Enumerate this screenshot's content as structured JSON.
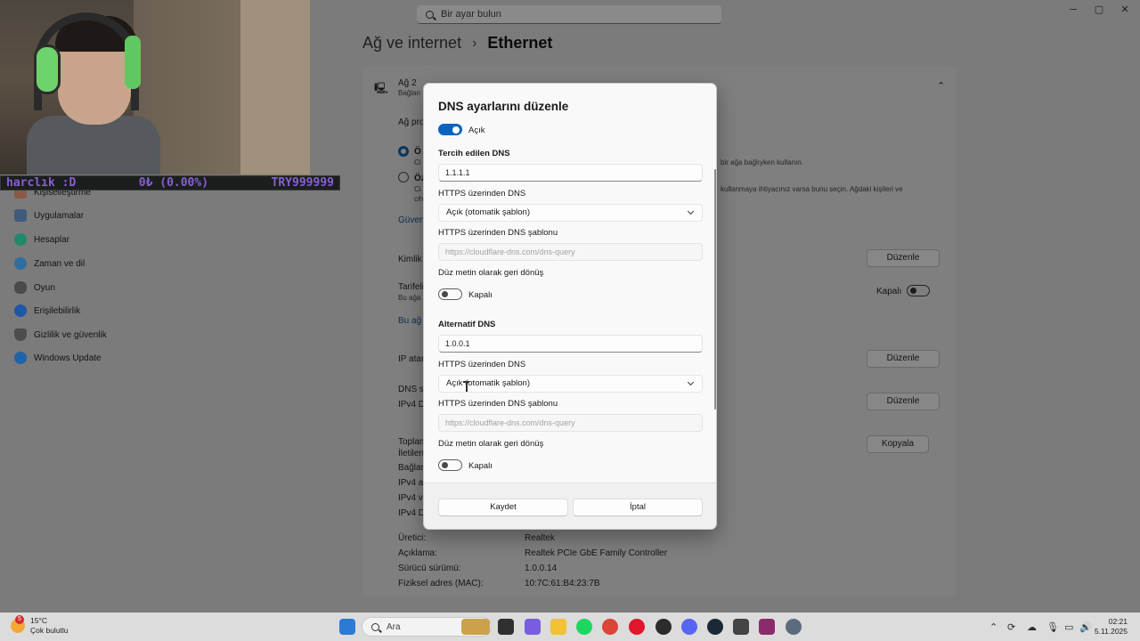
{
  "window": {
    "search_placeholder": "Bir ayar bulun",
    "minimize": "─",
    "maximize": "▢",
    "close": "✕"
  },
  "breadcrumb": {
    "parent": "Ağ ve internet",
    "separator": "›",
    "current": "Ethernet"
  },
  "sidebar": {
    "items": [
      {
        "label": "Kişiselleştirme",
        "icon": "brush-icon",
        "color": "#b5644a"
      },
      {
        "label": "Uygulamalar",
        "icon": "apps-icon",
        "color": "#3f5a7b"
      },
      {
        "label": "Hesaplar",
        "icon": "person-icon",
        "color": "#1f8a6b"
      },
      {
        "label": "Zaman ve dil",
        "icon": "globe-clock-icon",
        "color": "#2f6fa0"
      },
      {
        "label": "Oyun",
        "icon": "gamepad-icon",
        "color": "#4a4a4a"
      },
      {
        "label": "Erişilebilirlik",
        "icon": "accessibility-icon",
        "color": "#1f56a5"
      },
      {
        "label": "Gizlilik ve güvenlik",
        "icon": "shield-icon",
        "color": "#4d4d4d"
      },
      {
        "label": "Windows Update",
        "icon": "refresh-icon",
        "color": "#1f63a8"
      }
    ]
  },
  "ethernet": {
    "network_name": "Ağ 2",
    "network_status": "Bağlan",
    "profile_label": "Ağ pro",
    "radio_private": "Ö",
    "radio_private_desc": "Ci",
    "radio_private_desc_tail": "bir ağa bağlıyken kullanın.",
    "radio_public": "Öz",
    "radio_public_desc": "Ci",
    "radio_public_desc_tail": "kullanmaya ihtiyacınız varsa bunu seçin. Ağdaki kişileri ve",
    "radio_public_desc_2": "cih",
    "firewall_link": "Güven",
    "auth_label": "Kimlik",
    "metered_label": "Tarifeli",
    "metered_desc": "Bu ağa",
    "metered_state": "Kapalı",
    "data_link": "Bu ağ",
    "ip_label": "IP atan",
    "dns_label": "DNS su",
    "ipv4_dns_label": "IPv4 D",
    "total_label": "Toplam",
    "msg_label": "İletilen",
    "conn_label": "Bağlan",
    "ipv4_addr": "IPv4 ad",
    "ipv4_gw": "IPv4 va",
    "ipv4_dns2": "IPv4 D",
    "edit_button": "Düzenle",
    "copy_button": "Kopyala",
    "manufacturer_label": "Üretici:",
    "manufacturer_value": "Realtek",
    "description_label": "Açıklama:",
    "description_value": "Realtek PCIe GbE Family Controller",
    "driver_label": "Sürücü sürümü:",
    "driver_value": "1.0.0.14",
    "mac_label": "Fiziksel adres (MAC):",
    "mac_value": "10:7C:61:B4:23:7B"
  },
  "overlay": {
    "left": "harclık :D",
    "middle": "0₺ (0.00%)",
    "right": "TRY999999"
  },
  "dialog": {
    "title": "DNS ayarlarını düzenle",
    "ipv4_toggle_label": "Açık",
    "preferred_heading": "Tercih edilen DNS",
    "preferred_value": "1.1.1.1",
    "https_label": "HTTPS üzerinden DNS",
    "https_value": "Açık (otomatik şablon)",
    "template_label": "HTTPS üzerinden DNS şablonu",
    "template_placeholder": "https://cloudflare-dns.com/dns-query",
    "fallback_label": "Düz metin olarak geri dönüş",
    "fallback_state": "Kapalı",
    "alternate_heading": "Alternatif DNS",
    "alternate_value": "1.0.0.1",
    "alt_https_label": "HTTPS üzerinden DNS",
    "alt_https_value": "Açık (otomatik şablon)",
    "alt_template_label": "HTTPS üzerinden DNS şablonu",
    "alt_template_placeholder": "https://cloudflare-dns.com/dns-query",
    "alt_fallback_label": "Düz metin olarak geri dönüş",
    "alt_fallback_state": "Kapalı",
    "save": "Kaydet",
    "cancel": "İptal",
    "accent": "#0a63bf"
  },
  "taskbar": {
    "weather_badge": "5",
    "temperature": "15°C",
    "condition": "Çok bulutlu",
    "search_placeholder": "Ara",
    "time": "02:21",
    "date": "5.11.2025",
    "pinned": [
      {
        "name": "start-icon",
        "color": "#2b7bd6"
      },
      {
        "name": "widget-news-icon",
        "color": "#c9a24a"
      },
      {
        "name": "task-view-icon",
        "color": "#303030"
      },
      {
        "name": "copilot-icon",
        "color": "#7a5ce0"
      },
      {
        "name": "file-explorer-icon",
        "color": "#f2c230"
      },
      {
        "name": "spotify-icon",
        "color": "#1ed760"
      },
      {
        "name": "chrome-icon",
        "color": "#db4437"
      },
      {
        "name": "opera-icon",
        "color": "#e0162b"
      },
      {
        "name": "obs-icon",
        "color": "#2b2b2b"
      },
      {
        "name": "discord-icon",
        "color": "#5865f2"
      },
      {
        "name": "steam-icon",
        "color": "#1b2838"
      },
      {
        "name": "network-tool-icon",
        "color": "#444444"
      },
      {
        "name": "winrar-icon",
        "color": "#8b2b6b"
      },
      {
        "name": "settings-icon",
        "color": "#5a6b7d"
      }
    ]
  }
}
